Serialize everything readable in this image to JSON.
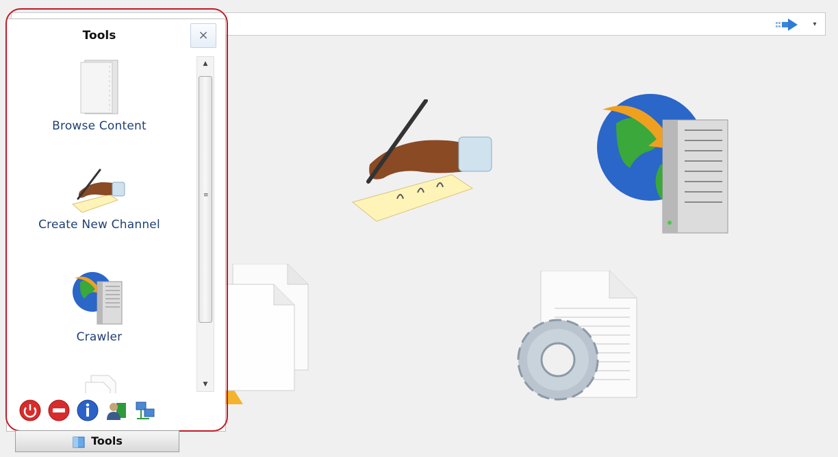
{
  "panel": {
    "title": "Tools",
    "close_label": "×",
    "items": [
      {
        "label": "Browse Content",
        "icon": "folder-icon"
      },
      {
        "label": "Create New Channel",
        "icon": "hand-pen-icon"
      },
      {
        "label": "Crawler",
        "icon": "globe-server-icon"
      },
      {
        "icon": "documents-icon"
      }
    ],
    "bottom_icons": [
      "power-icon",
      "stop-icon",
      "info-icon",
      "user-icon",
      "network-icon"
    ]
  },
  "tab": {
    "label": "Tools",
    "icon": "folder-blue-icon"
  },
  "topbar": {
    "go_icon": "go-arrow-icon",
    "dropdown": "▾"
  },
  "colors": {
    "highlight": "#c21a27",
    "label_blue": "#1f3f73"
  }
}
